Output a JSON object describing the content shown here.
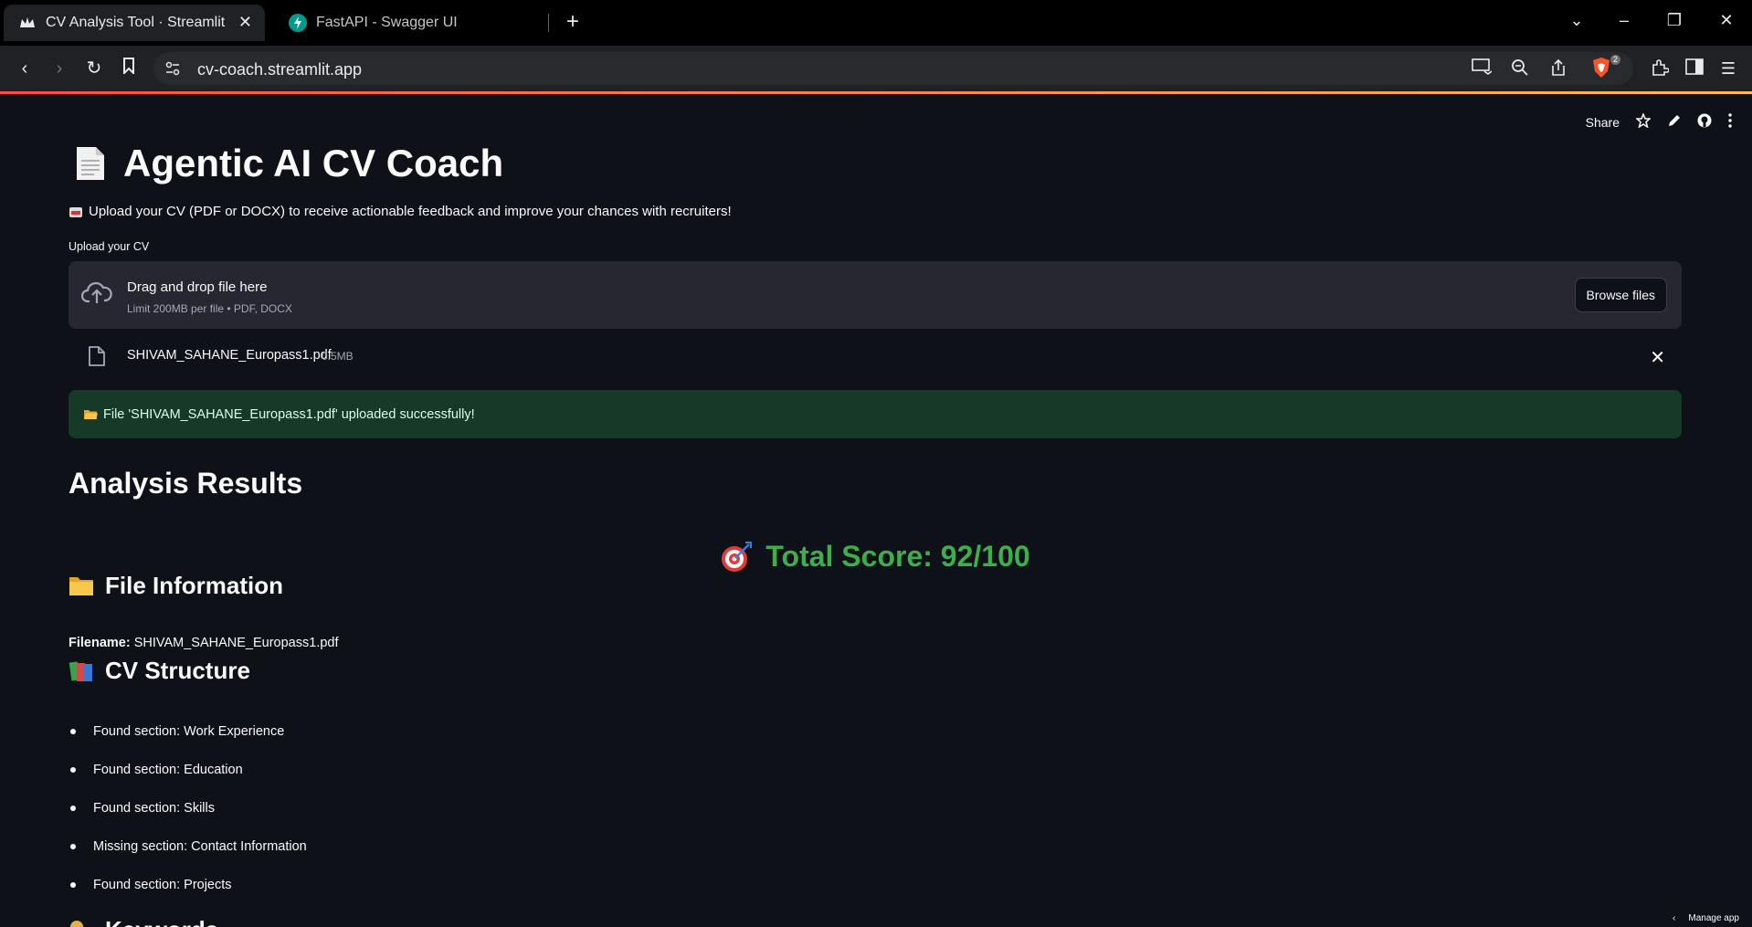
{
  "browser": {
    "tabs": [
      {
        "title": "CV Analysis Tool · Streamlit",
        "active": true,
        "favicon": "streamlit-crown-icon"
      },
      {
        "title": "FastAPI - Swagger UI",
        "active": false,
        "favicon": "fastapi-icon"
      }
    ],
    "url": "cv-coach.streamlit.app",
    "brave_badge": "2"
  },
  "app_header": {
    "share_label": "Share"
  },
  "page": {
    "title": "Agentic AI CV Coach",
    "subtitle": "Upload your CV (PDF or DOCX) to receive actionable feedback and improve your chances with recruiters!",
    "upload_label": "Upload your CV",
    "dropzone": {
      "title": "Drag and drop file here",
      "limit": "Limit 200MB per file • PDF, DOCX",
      "browse_label": "Browse files"
    },
    "uploaded_file": {
      "name": "SHIVAM_SAHANE_Europass1.pdf",
      "size": "0.5MB"
    },
    "success_message": "File 'SHIVAM_SAHANE_Europass1.pdf' uploaded successfully!",
    "results_heading": "Analysis Results",
    "total_score": "Total Score: 92/100",
    "file_info_heading": "File Information",
    "filename_label": "Filename:",
    "filename_value": "SHIVAM_SAHANE_Europass1.pdf",
    "structure_heading": "CV Structure",
    "structure_items": [
      "Found section: Work Experience",
      "Found section: Education",
      "Found section: Skills",
      "Missing section: Contact Information",
      "Found section: Projects"
    ],
    "keywords_heading": "Keywords"
  },
  "footer": {
    "manage_app": "Manage app"
  },
  "colors": {
    "background": "#0e1117",
    "score_green": "#3dae4b",
    "success_bg": "#173928",
    "dropzone_bg": "#262730"
  }
}
